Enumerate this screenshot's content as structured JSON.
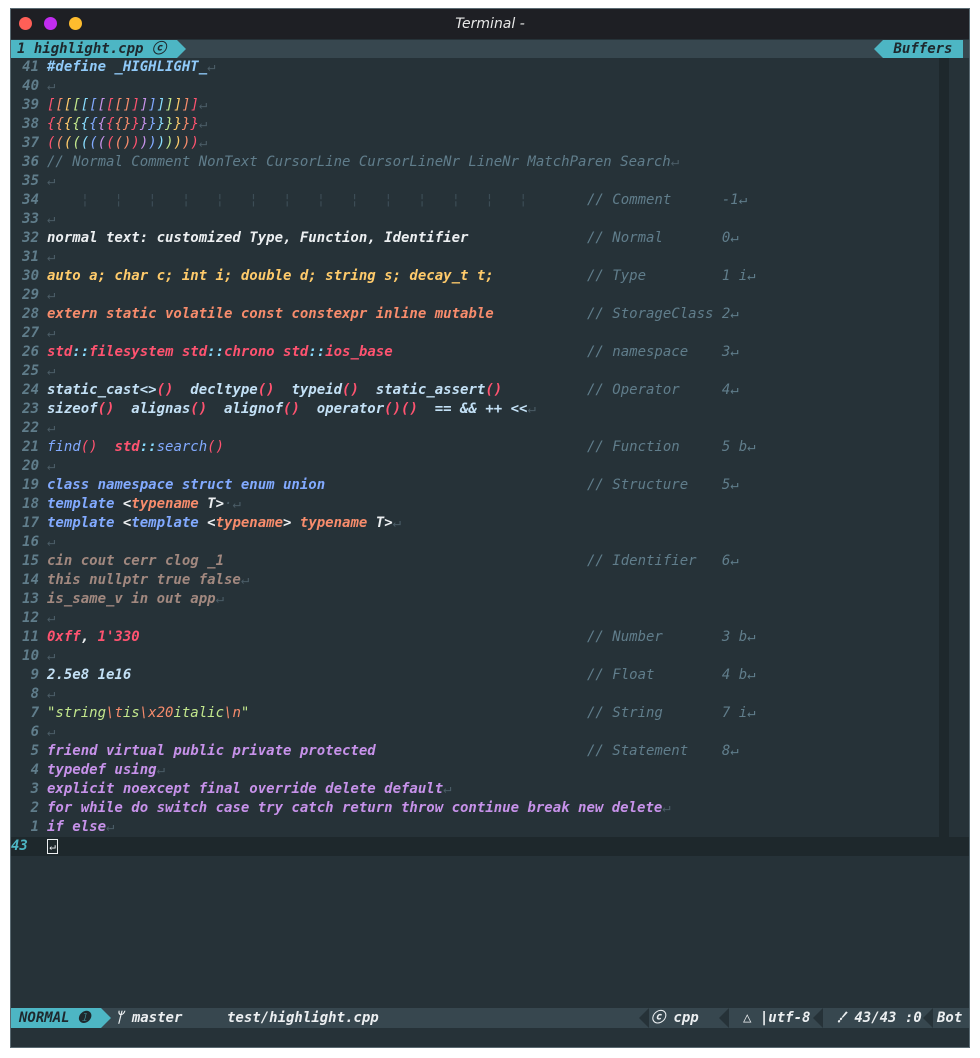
{
  "window": {
    "title": "Terminal -"
  },
  "tabline": {
    "active_tab": "1 highlight.cpp ⓒ",
    "buffers": "Buffers"
  },
  "lines": [
    {
      "n": "41",
      "segs": [
        [
          "#define _HIGHLIGHT_",
          "#90caf9",
          "b"
        ],
        [
          "↵",
          "#4a5c66",
          ""
        ]
      ],
      "c": ""
    },
    {
      "n": "40",
      "segs": [
        [
          "↵",
          "#4a5c66",
          ""
        ]
      ],
      "c": ""
    },
    {
      "n": "39",
      "segs": [
        [
          "[",
          "#ff5370",
          ""
        ],
        [
          "[",
          "#f78c6c",
          ""
        ],
        [
          "[",
          "#ffcb6b",
          ""
        ],
        [
          "[",
          "#c3e88d",
          ""
        ],
        [
          "[",
          "#89ddff",
          ""
        ],
        [
          "[",
          "#82aaff",
          ""
        ],
        [
          "[",
          "#c792ea",
          ""
        ],
        [
          "[",
          "#ff5370",
          ""
        ],
        [
          "[",
          "#f78c6c",
          ""
        ],
        [
          "]",
          "#f78c6c",
          ""
        ],
        [
          "]",
          "#ff5370",
          ""
        ],
        [
          "]",
          "#c792ea",
          ""
        ],
        [
          "]",
          "#82aaff",
          ""
        ],
        [
          "]",
          "#89ddff",
          ""
        ],
        [
          "]",
          "#c3e88d",
          ""
        ],
        [
          "]",
          "#ffcb6b",
          ""
        ],
        [
          "]",
          "#f78c6c",
          ""
        ],
        [
          "]",
          "#ff5370",
          ""
        ],
        [
          "↵",
          "#4a5c66",
          ""
        ]
      ],
      "c": ""
    },
    {
      "n": "38",
      "segs": [
        [
          "{",
          "#ff5370",
          ""
        ],
        [
          "{",
          "#f78c6c",
          ""
        ],
        [
          "{",
          "#ffcb6b",
          ""
        ],
        [
          "{",
          "#c3e88d",
          ""
        ],
        [
          "{",
          "#89ddff",
          ""
        ],
        [
          "{",
          "#82aaff",
          ""
        ],
        [
          "{",
          "#c792ea",
          ""
        ],
        [
          "{",
          "#ff5370",
          ""
        ],
        [
          "{",
          "#f78c6c",
          ""
        ],
        [
          "}",
          "#f78c6c",
          ""
        ],
        [
          "}",
          "#ff5370",
          ""
        ],
        [
          "}",
          "#c792ea",
          ""
        ],
        [
          "}",
          "#82aaff",
          ""
        ],
        [
          "}",
          "#89ddff",
          ""
        ],
        [
          "}",
          "#c3e88d",
          ""
        ],
        [
          "}",
          "#ffcb6b",
          ""
        ],
        [
          "}",
          "#f78c6c",
          ""
        ],
        [
          "}",
          "#ff5370",
          ""
        ],
        [
          "↵",
          "#4a5c66",
          ""
        ]
      ],
      "c": ""
    },
    {
      "n": "37",
      "segs": [
        [
          "(",
          "#ff5370",
          ""
        ],
        [
          "(",
          "#f78c6c",
          ""
        ],
        [
          "(",
          "#ffcb6b",
          ""
        ],
        [
          "(",
          "#c3e88d",
          ""
        ],
        [
          "(",
          "#89ddff",
          ""
        ],
        [
          "(",
          "#82aaff",
          ""
        ],
        [
          "(",
          "#c792ea",
          ""
        ],
        [
          "(",
          "#ff5370",
          ""
        ],
        [
          "(",
          "#f78c6c",
          ""
        ],
        [
          ")",
          "#f78c6c",
          ""
        ],
        [
          ")",
          "#ff5370",
          ""
        ],
        [
          ")",
          "#c792ea",
          ""
        ],
        [
          ")",
          "#82aaff",
          ""
        ],
        [
          ")",
          "#89ddff",
          ""
        ],
        [
          ")",
          "#c3e88d",
          ""
        ],
        [
          ")",
          "#ffcb6b",
          ""
        ],
        [
          ")",
          "#f78c6c",
          ""
        ],
        [
          ")",
          "#ff5370",
          ""
        ],
        [
          "↵",
          "#4a5c66",
          ""
        ]
      ],
      "c": ""
    },
    {
      "n": "36",
      "segs": [
        [
          "// Normal Comment NonText CursorLine CursorLineNr LineNr MatchParen Search",
          "#607d8b",
          ""
        ],
        [
          "↵",
          "#4a5c66",
          ""
        ]
      ],
      "c": ""
    },
    {
      "n": "35",
      "segs": [
        [
          "↵",
          "#4a5c66",
          ""
        ]
      ],
      "c": ""
    },
    {
      "n": "34",
      "segs": [
        [
          "    ¦   ¦   ¦   ¦   ¦   ¦   ¦   ¦   ¦   ¦   ¦   ¦   ¦   ¦",
          "#3c4d56",
          ""
        ]
      ],
      "c": "// Comment      -1↵"
    },
    {
      "n": "33",
      "segs": [
        [
          "↵",
          "#4a5c66",
          ""
        ]
      ],
      "c": ""
    },
    {
      "n": "32",
      "segs": [
        [
          "normal text: customized Type, Function, Identifier",
          "#eceff1",
          "b"
        ]
      ],
      "c": "// Normal       0↵"
    },
    {
      "n": "31",
      "segs": [
        [
          "↵",
          "#4a5c66",
          ""
        ]
      ],
      "c": ""
    },
    {
      "n": "30",
      "segs": [
        [
          "auto a; char c; int i; double d; string s; decay_t t;",
          "#ffcb6b",
          "b"
        ]
      ],
      "c": "// Type         1 i↵"
    },
    {
      "n": "29",
      "segs": [
        [
          "↵",
          "#4a5c66",
          ""
        ]
      ],
      "c": ""
    },
    {
      "n": "28",
      "segs": [
        [
          "extern static volatile const constexpr inline mutable",
          "#f78c6c",
          "b"
        ]
      ],
      "c": "// StorageClass 2↵"
    },
    {
      "n": "27",
      "segs": [
        [
          "↵",
          "#4a5c66",
          ""
        ]
      ],
      "c": ""
    },
    {
      "n": "26",
      "segs": [
        [
          "std",
          "#ff5370",
          "b"
        ],
        [
          "::",
          "#89ddff",
          "b"
        ],
        [
          "filesystem ",
          "#ff5370",
          "b"
        ],
        [
          "std",
          "#ff5370",
          "b"
        ],
        [
          "::",
          "#89ddff",
          "b"
        ],
        [
          "chrono ",
          "#ff5370",
          "b"
        ],
        [
          "std",
          "#ff5370",
          "b"
        ],
        [
          "::",
          "#89ddff",
          "b"
        ],
        [
          "ios_base",
          "#ff5370",
          "b"
        ]
      ],
      "c": "// namespace    3↵"
    },
    {
      "n": "25",
      "segs": [
        [
          "↵",
          "#4a5c66",
          ""
        ]
      ],
      "c": ""
    },
    {
      "n": "24",
      "segs": [
        [
          "static_cast<>",
          "#c3e0f5",
          "b"
        ],
        [
          "()",
          "#ff5370",
          "b"
        ],
        [
          "  decltype",
          "#c3e0f5",
          "b"
        ],
        [
          "()",
          "#ff5370",
          "b"
        ],
        [
          "  typeid",
          "#c3e0f5",
          "b"
        ],
        [
          "()",
          "#ff5370",
          "b"
        ],
        [
          "  static_assert",
          "#c3e0f5",
          "b"
        ],
        [
          "()",
          "#ff5370",
          "b"
        ]
      ],
      "c": "// Operator     4↵"
    },
    {
      "n": "23",
      "segs": [
        [
          "sizeof",
          "#c3e0f5",
          "b"
        ],
        [
          "()",
          "#ff5370",
          "b"
        ],
        [
          "  alignas",
          "#c3e0f5",
          "b"
        ],
        [
          "()",
          "#ff5370",
          "b"
        ],
        [
          "  alignof",
          "#c3e0f5",
          "b"
        ],
        [
          "()",
          "#ff5370",
          "b"
        ],
        [
          "  operator",
          "#c3e0f5",
          "b"
        ],
        [
          "()()",
          "#ff5370",
          "b"
        ],
        [
          "  == && ++ <<",
          "#c3e0f5",
          "b"
        ],
        [
          "↵",
          "#4a5c66",
          ""
        ]
      ],
      "c": ""
    },
    {
      "n": "22",
      "segs": [
        [
          "↵",
          "#4a5c66",
          ""
        ]
      ],
      "c": ""
    },
    {
      "n": "21",
      "segs": [
        [
          "find",
          "#82aaff",
          ""
        ],
        [
          "()",
          "#ff5370",
          ""
        ],
        [
          "  ",
          "#82aaff",
          ""
        ],
        [
          "std",
          "#ff5370",
          "b"
        ],
        [
          "::",
          "#89ddff",
          "b"
        ],
        [
          "search",
          "#82aaff",
          ""
        ],
        [
          "()",
          "#ff5370",
          ""
        ]
      ],
      "c": "// Function     5 b↵"
    },
    {
      "n": "20",
      "segs": [
        [
          "↵",
          "#4a5c66",
          ""
        ]
      ],
      "c": ""
    },
    {
      "n": "19",
      "segs": [
        [
          "class namespace struct enum union",
          "#82aaff",
          "b"
        ]
      ],
      "c": "// Structure    5↵"
    },
    {
      "n": "18",
      "segs": [
        [
          "template ",
          "#82aaff",
          "b"
        ],
        [
          "<",
          "#eceff1",
          "b"
        ],
        [
          "typename ",
          "#f78c6c",
          "b"
        ],
        [
          "T",
          "#eceff1",
          "b"
        ],
        [
          ">",
          "#eceff1",
          "b"
        ],
        [
          "·↵",
          "#4a5c66",
          ""
        ]
      ],
      "c": ""
    },
    {
      "n": "17",
      "segs": [
        [
          "template ",
          "#82aaff",
          "b"
        ],
        [
          "<",
          "#eceff1",
          "b"
        ],
        [
          "template ",
          "#82aaff",
          "b"
        ],
        [
          "<",
          "#eceff1",
          "b"
        ],
        [
          "typename",
          "#f78c6c",
          "b"
        ],
        [
          "> ",
          "#eceff1",
          "b"
        ],
        [
          "typename ",
          "#f78c6c",
          "b"
        ],
        [
          "T",
          "#eceff1",
          "b"
        ],
        [
          ">",
          "#eceff1",
          "b"
        ],
        [
          "↵",
          "#4a5c66",
          ""
        ]
      ],
      "c": ""
    },
    {
      "n": "16",
      "segs": [
        [
          "↵",
          "#4a5c66",
          ""
        ]
      ],
      "c": ""
    },
    {
      "n": "15",
      "segs": [
        [
          "cin cout cerr clog _1",
          "#a1887f",
          "b"
        ]
      ],
      "c": "// Identifier   6↵"
    },
    {
      "n": "14",
      "segs": [
        [
          "this nullptr true false",
          "#a1887f",
          "b"
        ],
        [
          "↵",
          "#4a5c66",
          ""
        ]
      ],
      "c": ""
    },
    {
      "n": "13",
      "segs": [
        [
          "is_same_v in out app",
          "#a1887f",
          "b"
        ],
        [
          "↵",
          "#4a5c66",
          ""
        ]
      ],
      "c": ""
    },
    {
      "n": "12",
      "segs": [
        [
          "↵",
          "#4a5c66",
          ""
        ]
      ],
      "c": ""
    },
    {
      "n": "11",
      "segs": [
        [
          "0xff",
          "#ff5370",
          "b"
        ],
        [
          ", ",
          "#eceff1",
          "b"
        ],
        [
          "1'330",
          "#ff5370",
          "b"
        ]
      ],
      "c": "// Number       3 b↵"
    },
    {
      "n": "10",
      "segs": [
        [
          "↵",
          "#4a5c66",
          ""
        ]
      ],
      "c": ""
    },
    {
      "n": "9",
      "segs": [
        [
          "2.5e8 1e16",
          "#c3e0f5",
          "b"
        ]
      ],
      "c": "// Float        4 b↵"
    },
    {
      "n": "8",
      "segs": [
        [
          "↵",
          "#4a5c66",
          ""
        ]
      ],
      "c": ""
    },
    {
      "n": "7",
      "segs": [
        [
          "\"string",
          "#c3e88d",
          ""
        ],
        [
          "\\t",
          "#f78c6c",
          ""
        ],
        [
          "is",
          "#c3e88d",
          ""
        ],
        [
          "\\x20",
          "#f78c6c",
          ""
        ],
        [
          "italic",
          "#c3e88d",
          ""
        ],
        [
          "\\n",
          "#f78c6c",
          ""
        ],
        [
          "\"",
          "#c3e88d",
          ""
        ]
      ],
      "c": "// String       7 i↵"
    },
    {
      "n": "6",
      "segs": [
        [
          "↵",
          "#4a5c66",
          ""
        ]
      ],
      "c": ""
    },
    {
      "n": "5",
      "segs": [
        [
          "friend virtual public private protected",
          "#c792ea",
          "b"
        ]
      ],
      "c": "// Statement    8↵"
    },
    {
      "n": "4",
      "segs": [
        [
          "typedef using",
          "#c792ea",
          "b"
        ],
        [
          "↵",
          "#4a5c66",
          ""
        ]
      ],
      "c": ""
    },
    {
      "n": "3",
      "segs": [
        [
          "explicit noexcept final override delete default",
          "#c792ea",
          "b"
        ],
        [
          "↵",
          "#4a5c66",
          ""
        ]
      ],
      "c": ""
    },
    {
      "n": "2",
      "segs": [
        [
          "for while do switch case try catch return throw continue break new delete",
          "#c792ea",
          "b"
        ],
        [
          "↵",
          "#4a5c66",
          ""
        ]
      ],
      "c": ""
    },
    {
      "n": "1",
      "segs": [
        [
          "if else",
          "#c792ea",
          "b"
        ],
        [
          "↵",
          "#4a5c66",
          ""
        ]
      ],
      "c": ""
    }
  ],
  "cursor_line": {
    "number": "43",
    "char": "↵"
  },
  "statusline": {
    "mode": "NORMAL ➊",
    "branch": "ᛘ master",
    "file": "test/highlight.cpp",
    "filetype": "ⓒ cpp",
    "encoding": "△ |utf-8",
    "position": "⹓ 43/43 :0",
    "scroll": "Bot"
  },
  "colors": {
    "bg": "#263238",
    "accent": "#4db6c4",
    "close": "#ff5f57",
    "min": "#c12cf0",
    "max": "#febc2e"
  }
}
